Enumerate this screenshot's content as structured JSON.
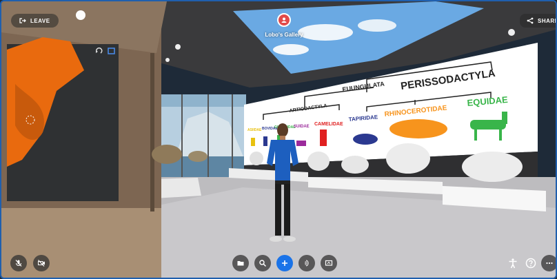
{
  "topbar": {
    "leave_label": "LEAVE",
    "share_label": "SHARE",
    "gallery_title": "Lobo's Gallery"
  },
  "wall_tree": {
    "clade_top": "EUUNGULATA",
    "order_left": "ARTIODACTYLA",
    "order_right": "PERISSODACTYLA",
    "families_left": [
      "ASIIDAE",
      "BOVIDAE",
      "GIRAFFIDAE",
      "SUIDAE",
      "CAMELIDAE"
    ],
    "families_right": [
      "TAPIRIDAE",
      "RHINOCEROTIDAE",
      "EQUIDAE"
    ]
  },
  "colors": {
    "accent_blue": "#1a73e8",
    "frame_border": "#1f5fae",
    "rhino_orange": "#f7941d",
    "equid_green": "#39b54a",
    "camel_red": "#e02020",
    "tapir_navy": "#2b3990"
  },
  "toolbar_icons": {
    "left": [
      "mic-off-icon",
      "camera-off-icon"
    ],
    "center": [
      "folder-icon",
      "search-icon",
      "plus-icon",
      "emote-icon",
      "screen-share-icon"
    ],
    "right": [
      "accessibility-icon",
      "help-icon",
      "more-icon"
    ]
  }
}
